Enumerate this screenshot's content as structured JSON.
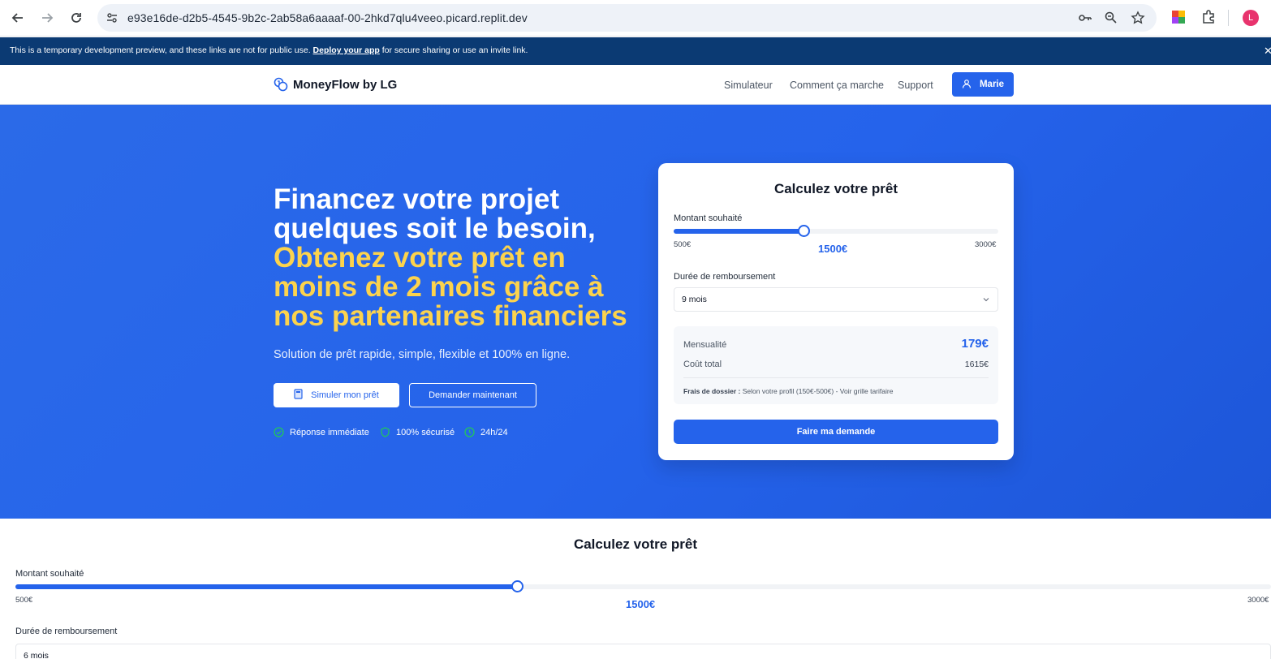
{
  "browser": {
    "url": "e93e16de-d2b5-4545-9b2c-2ab58a6aaaaf-00-2hkd7qlu4veeo.picard.replit.dev",
    "profile_initial": "L"
  },
  "banner": {
    "text_before": "This is a temporary development preview, and these links are not for public use. ",
    "link": "Deploy your app",
    "text_after": " for secure sharing or use an invite link."
  },
  "header": {
    "brand": "MoneyFlow by LG",
    "nav": [
      "Simulateur",
      "Comment ça marche",
      "Support"
    ],
    "user": "Marie"
  },
  "hero": {
    "title_line1": "Financez votre projet quelques soit le besoin,",
    "title_accent": "Obtenez votre prêt en moins de 2 mois grâce à nos partenaires financiers",
    "subtitle": "Solution de prêt rapide, simple, flexible et 100% en ligne.",
    "btn_simulate": "Simuler mon prêt",
    "btn_request": "Demander maintenant",
    "features": [
      "Réponse immédiate",
      "100% sécurisé",
      "24h/24"
    ]
  },
  "calculator": {
    "title": "Calculez votre prêt",
    "amount_label": "Montant souhaité",
    "amount_min": "500€",
    "amount_max": "3000€",
    "amount_value": "1500€",
    "amount_fraction": 0.4,
    "duration_label": "Durée de remboursement",
    "duration_value": "9 mois",
    "monthly_label": "Mensualité",
    "monthly_value": "179€",
    "total_label": "Coût total",
    "total_value": "1615€",
    "fees_label": "Frais de dossier :",
    "fees_text": " Selon votre profil (150€-500€) - Voir grille tarifaire",
    "submit": "Faire ma demande"
  },
  "lower_calculator": {
    "title": "Calculez votre prêt",
    "amount_label": "Montant souhaité",
    "amount_min": "500€",
    "amount_max": "3000€",
    "amount_value": "1500€",
    "amount_fraction": 0.4,
    "duration_label": "Durée de remboursement",
    "duration_value": "6 mois"
  },
  "colors": {
    "primary": "#2563eb",
    "accent_yellow": "#fcd34d",
    "feature_green": "#22c55e",
    "banner_bg": "#0b3a73"
  }
}
